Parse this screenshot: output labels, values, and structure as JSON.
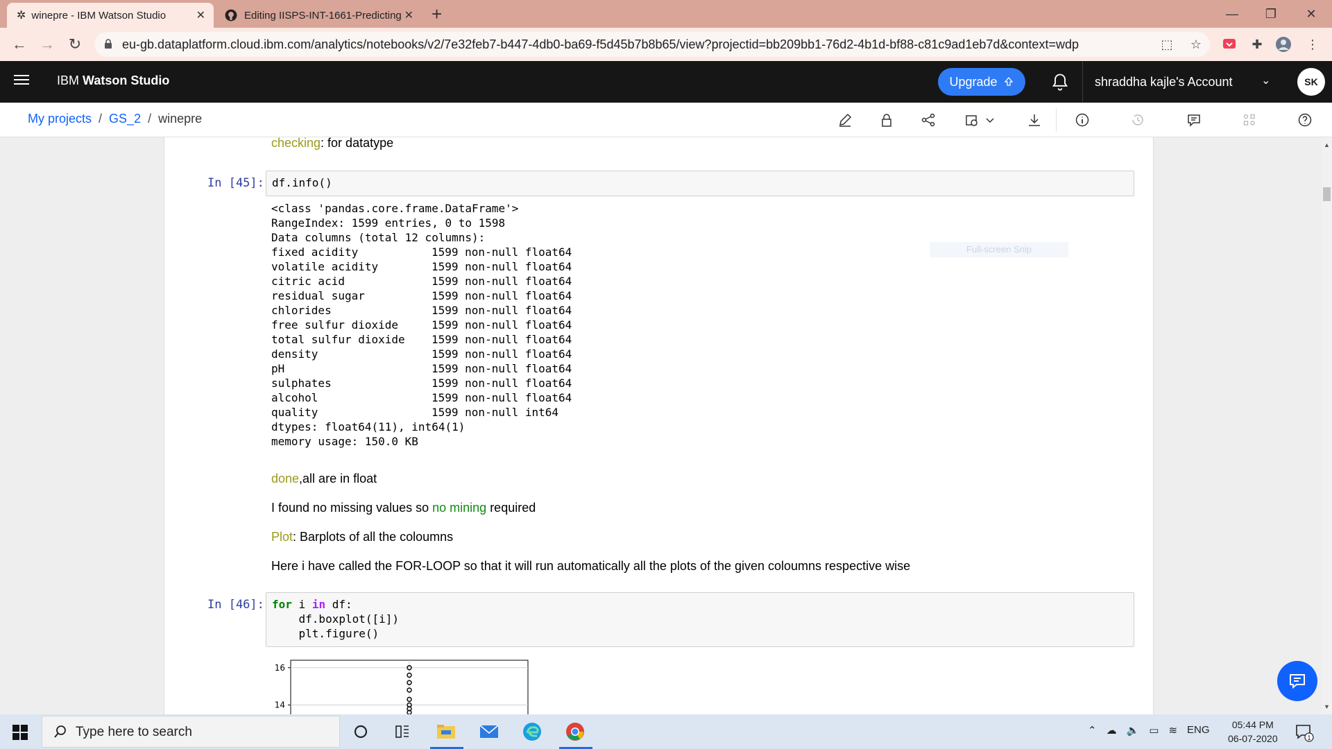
{
  "browser": {
    "tabs": [
      {
        "title": "winepre - IBM Watson Studio",
        "close": "✕"
      },
      {
        "title": "Editing IISPS-INT-1661-Predicting",
        "close": "✕"
      }
    ],
    "new_tab": "+",
    "url": "eu-gb.dataplatform.cloud.ibm.com/analytics/notebooks/v2/7e32feb7-b447-4db0-ba69-f5d45b7b8b65/view?projectid=bb209bb1-76d2-4b1d-bf88-c81c9ad1eb7d&context=wdp"
  },
  "header": {
    "brand_prefix": "IBM",
    "brand_name": "Watson Studio",
    "upgrade_label": "Upgrade",
    "account_label": "shraddha kajle's Account",
    "avatar_initials": "SK"
  },
  "breadcrumb": {
    "items": [
      "My projects",
      "GS_2"
    ],
    "current": "winepre",
    "separator": "/"
  },
  "notebook": {
    "md_checking": {
      "hl": "checking",
      "rest": ": for datatype"
    },
    "cell45": {
      "prompt": "In [45]:",
      "code": "df.info()"
    },
    "output45": {
      "head": [
        "<class 'pandas.core.frame.DataFrame'>",
        "RangeIndex: 1599 entries, 0 to 1598",
        "Data columns (total 12 columns):"
      ],
      "columns": [
        {
          "name": "fixed acidity",
          "info": "1599 non-null float64"
        },
        {
          "name": "volatile acidity",
          "info": "1599 non-null float64"
        },
        {
          "name": "citric acid",
          "info": "1599 non-null float64"
        },
        {
          "name": "residual sugar",
          "info": "1599 non-null float64"
        },
        {
          "name": "chlorides",
          "info": "1599 non-null float64"
        },
        {
          "name": "free sulfur dioxide",
          "info": "1599 non-null float64"
        },
        {
          "name": "total sulfur dioxide",
          "info": "1599 non-null float64"
        },
        {
          "name": "density",
          "info": "1599 non-null float64"
        },
        {
          "name": "pH",
          "info": "1599 non-null float64"
        },
        {
          "name": "sulphates",
          "info": "1599 non-null float64"
        },
        {
          "name": "alcohol",
          "info": "1599 non-null float64"
        },
        {
          "name": "quality",
          "info": "1599 non-null int64"
        }
      ],
      "tail": [
        "dtypes: float64(11), int64(1)",
        "memory usage: 150.0 KB"
      ]
    },
    "md_done": {
      "hl": "done",
      "rest": ",all are in float"
    },
    "md_missing": {
      "pre": "I found no missing values so ",
      "hl": "no mining",
      "post": " required"
    },
    "md_plot": {
      "hl": "Plot",
      "rest": ": Barplots of all the coloumns"
    },
    "md_loop": "Here i have called the FOR-LOOP so that it will run automatically all the plots of the given coloumns respective wise",
    "cell46": {
      "prompt": "In [46]:",
      "line1": {
        "kw_for": "for",
        "var": " i ",
        "kw_in": "in",
        "rest": " df:"
      },
      "line2": "    df.boxplot([i])",
      "line3": "    plt.figure()"
    },
    "snip_hint": "Full-screen Snip"
  },
  "chart_data": {
    "type": "scatter",
    "title": "",
    "xlabel": "",
    "ylabel": "",
    "ylim_visible": [
      13.5,
      16.4
    ],
    "yticks": [
      14,
      16
    ],
    "note": "Top of a boxplot; only outlier markers visible",
    "outliers_y": [
      16.0,
      15.6,
      15.2,
      14.8,
      14.3,
      14.0,
      13.8,
      13.6
    ]
  },
  "taskbar": {
    "search_placeholder": "Type here to search",
    "lang": "ENG",
    "time": "05:44 PM",
    "date": "06-07-2020",
    "notif_count": "1"
  }
}
